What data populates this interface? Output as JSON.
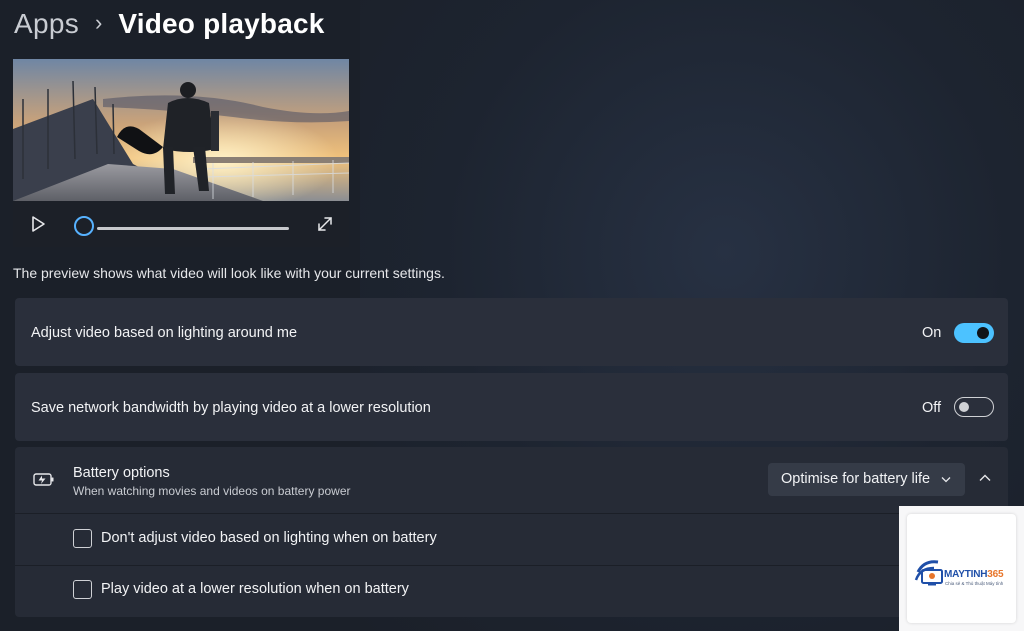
{
  "breadcrumb": {
    "parent": "Apps",
    "separator": "›",
    "title": "Video playback"
  },
  "player": {
    "progress_percent": 0,
    "play_icon": "play-icon",
    "expand_icon": "expand-icon"
  },
  "description": "The preview shows what video will look like with your current settings.",
  "settings": {
    "lighting": {
      "label": "Adjust video based on lighting around me",
      "state_text": "On",
      "enabled": true
    },
    "bandwidth": {
      "label": "Save network bandwidth by playing video at a lower resolution",
      "state_text": "Off",
      "enabled": false
    },
    "battery": {
      "title": "Battery options",
      "subtitle": "When watching movies and videos on battery power",
      "dropdown_value": "Optimise for battery life",
      "icon": "battery-saver-icon",
      "options": [
        {
          "label": "Don't adjust video based on lighting when on battery",
          "checked": false
        },
        {
          "label": "Play video at a lower resolution when on battery",
          "checked": false
        }
      ]
    }
  },
  "watermark": {
    "brand_main": "MAYTINH",
    "brand_accent": "365",
    "tagline": "Chia sẻ & Thủ thuật Máy tính"
  },
  "colors": {
    "accent": "#4cc2ff",
    "background": "#1b2029",
    "card": "#2a2f3b"
  }
}
